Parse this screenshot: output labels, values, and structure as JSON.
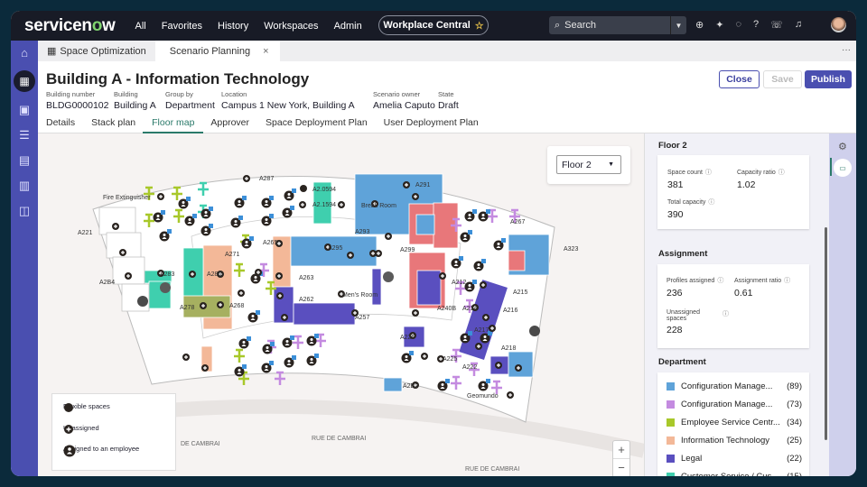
{
  "topbar": {
    "logo_a": "servicen",
    "logo_b": "o",
    "logo_c": "w",
    "nav": [
      "All",
      "Favorites",
      "History",
      "Workspaces",
      "Admin"
    ],
    "workspace": "Workplace Central",
    "search_placeholder": "Search"
  },
  "tabs": [
    {
      "label": "Space Optimization"
    },
    {
      "label": "Scenario Planning"
    }
  ],
  "header": {
    "title": "Building A - Information Technology",
    "fields": [
      {
        "label": "Building number",
        "value": "BLDG0000102"
      },
      {
        "label": "Building",
        "value": "Building A"
      },
      {
        "label": "Group by",
        "value": "Department"
      },
      {
        "label": "Location",
        "value": "Campus 1 New York, Building A"
      },
      {
        "label": "Scenario owner",
        "value": "Amelia Caputo"
      },
      {
        "label": "State",
        "value": "Draft"
      }
    ],
    "buttons": {
      "close": "Close",
      "save": "Save",
      "publish": "Publish"
    },
    "subtabs": [
      "Details",
      "Stack plan",
      "Floor map",
      "Approver",
      "Space Deployment Plan",
      "User Deployment Plan"
    ]
  },
  "map": {
    "floor_select": "Floor 2",
    "rooms": [
      "A221",
      "A2B4",
      "A283",
      "A280",
      "A278",
      "A271",
      "A268",
      "A265",
      "A263",
      "A262",
      "A287",
      "A2.0594",
      "A2.1594",
      "Break Room",
      "A291",
      "A293",
      "A295",
      "A299",
      "A257",
      "Men's Room",
      "A212",
      "A240B",
      "A214",
      "A217",
      "A215",
      "A216",
      "A218",
      "A222",
      "A226",
      "A225",
      "A2B2",
      "A267",
      "A323",
      "Geomundo",
      "Fire Extinguisher"
    ],
    "streets": [
      "DE CAMBRAI",
      "RUE DE CAMBRAI",
      "RUE DE CAMBRAI"
    ],
    "legend": [
      "Flexible spaces",
      "Unassigned",
      "Assigned to an employee"
    ],
    "zoom_in": "+",
    "zoom_out": "−"
  },
  "panel": {
    "floor_title": "Floor 2",
    "space_count_label": "Space count",
    "space_count": "381",
    "capacity_ratio_label": "Capacity ratio",
    "capacity_ratio": "1.02",
    "total_capacity_label": "Total capacity",
    "total_capacity": "390",
    "assignment_title": "Assignment",
    "profiles_label": "Profiles assigned",
    "profiles": "236",
    "ratio_label": "Assignment ratio",
    "ratio": "0.61",
    "unassigned_label": "Unassigned spaces",
    "unassigned": "228",
    "department_title": "Department",
    "departments": [
      {
        "name": "Configuration Manage...",
        "count": "(89)",
        "color": "#5fa3d9"
      },
      {
        "name": "Configuration Manage...",
        "count": "(73)",
        "color": "#c48be0"
      },
      {
        "name": "Employee Service Centr...",
        "count": "(34)",
        "color": "#a8c82a"
      },
      {
        "name": "Information Technology",
        "count": "(25)",
        "color": "#f3b898"
      },
      {
        "name": "Legal",
        "count": "(22)",
        "color": "#5a4fbf"
      },
      {
        "name": "Customer Service / Cus...",
        "count": "(15)",
        "color": "#3fcfae"
      }
    ]
  }
}
